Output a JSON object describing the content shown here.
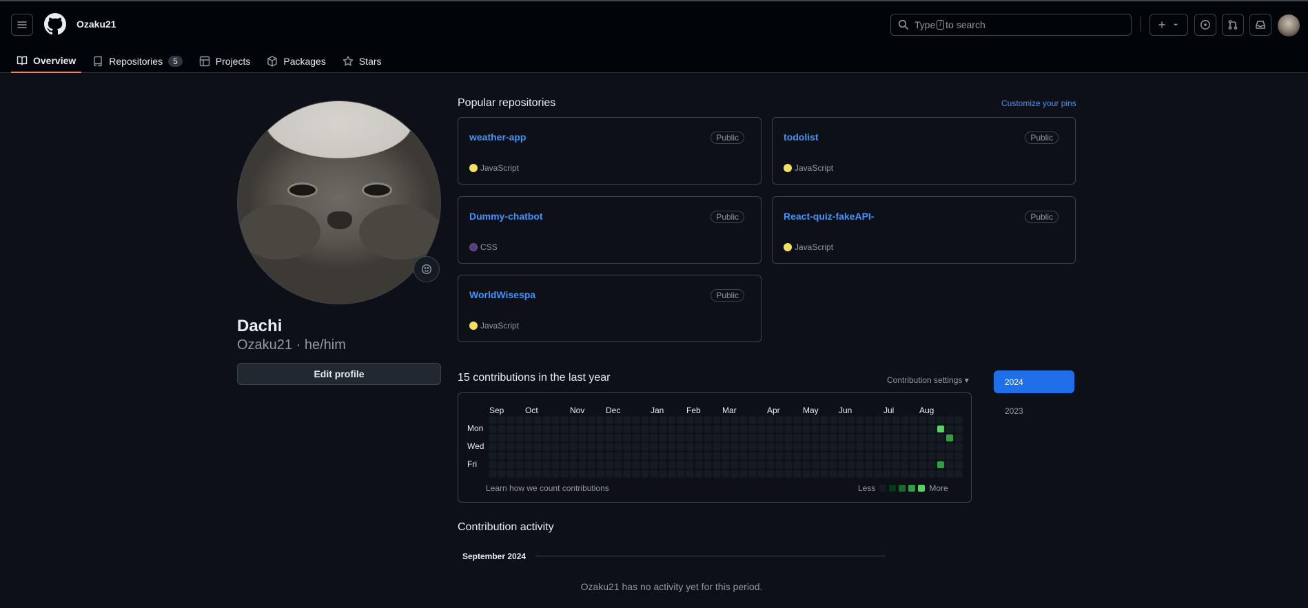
{
  "header": {
    "username": "Ozaku21",
    "search_prefix": "Type",
    "search_key": "/",
    "search_suffix": "to search",
    "plus": "+"
  },
  "tabs": [
    {
      "label": "Overview",
      "icon": "book-icon",
      "active": true
    },
    {
      "label": "Repositories",
      "icon": "repo-icon",
      "count": "5"
    },
    {
      "label": "Projects",
      "icon": "table-icon"
    },
    {
      "label": "Packages",
      "icon": "package-icon"
    },
    {
      "label": "Stars",
      "icon": "star-icon"
    }
  ],
  "profile": {
    "name": "Dachi",
    "login_line": "Ozaku21 · he/him",
    "edit_label": "Edit profile"
  },
  "popular": {
    "title": "Popular repositories",
    "customize": "Customize your pins",
    "repos": [
      {
        "name": "weather-app",
        "visibility": "Public",
        "language": "JavaScript",
        "color": "#f1e05a"
      },
      {
        "name": "todolist",
        "visibility": "Public",
        "language": "JavaScript",
        "color": "#f1e05a"
      },
      {
        "name": "Dummy-chatbot",
        "visibility": "Public",
        "language": "CSS",
        "color": "#563d7c"
      },
      {
        "name": "React-quiz-fakeAPI-",
        "visibility": "Public",
        "language": "JavaScript",
        "color": "#f1e05a"
      },
      {
        "name": "WorldWisespa",
        "visibility": "Public",
        "language": "JavaScript",
        "color": "#f1e05a"
      }
    ]
  },
  "contributions": {
    "title": "15 contributions in the last year",
    "settings": "Contribution settings ▾",
    "months": [
      "Sep",
      "Oct",
      "Nov",
      "Dec",
      "Jan",
      "Feb",
      "Mar",
      "Apr",
      "May",
      "Jun",
      "Jul",
      "Aug"
    ],
    "days": [
      "Mon",
      "Wed",
      "Fri"
    ],
    "learn": "Learn how we count contributions",
    "less": "Less",
    "more": "More",
    "colors": [
      "#151b23",
      "#033a16",
      "#196c2e",
      "#2ea043",
      "#56d364"
    ]
  },
  "years": [
    "2024",
    "2023"
  ],
  "activity": {
    "title": "Contribution activity",
    "month": "September 2024",
    "empty": "Ozaku21 has no activity yet for this period."
  }
}
